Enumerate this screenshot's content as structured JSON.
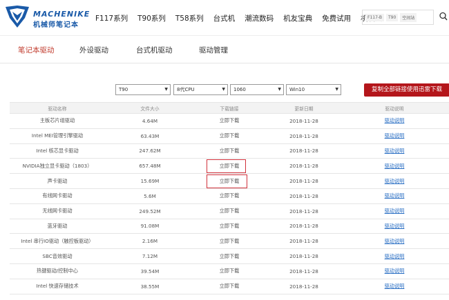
{
  "header": {
    "logo_en": "MACHENIKE",
    "logo_cn": "机械师笔记本",
    "nav": [
      "F117系列",
      "T90系列",
      "T58系列",
      "台式机",
      "潮流数码",
      "机友宝典",
      "免费试用",
      "机友会"
    ],
    "search_tags": [
      "F117-B",
      "T90",
      "空间站"
    ]
  },
  "subnav": {
    "items": [
      "笔记本驱动",
      "外设驱动",
      "台式机驱动",
      "驱动管理"
    ],
    "active": "笔记本驱动"
  },
  "filters": {
    "model": "T90",
    "cpu": "8代CPU",
    "gpu": "1060",
    "os": "Win10",
    "copy_button": "复制全部链接使用迅雷下载"
  },
  "table": {
    "headers": [
      "驱动名称",
      "文件大小",
      "下载链接",
      "更新日期",
      "驱动说明"
    ],
    "rows": [
      {
        "name": "主板芯片组驱动",
        "size": "4.64M",
        "link": "立即下载",
        "date": "2018-11-28",
        "desc": "驱动说明"
      },
      {
        "name": "Intel MEI管理引擎驱动",
        "size": "63.43M",
        "link": "立即下载",
        "date": "2018-11-28",
        "desc": "驱动说明"
      },
      {
        "name": "Intel 核芯显卡驱动",
        "size": "247.62M",
        "link": "立即下载",
        "date": "2018-11-28",
        "desc": "驱动说明"
      },
      {
        "name": "NVIDIA独立显卡驱动（1803）",
        "size": "657.48M",
        "link": "立即下载",
        "date": "2018-11-28",
        "desc": "驱动说明"
      },
      {
        "name": "声卡驱动",
        "size": "15.69M",
        "link": "立即下载",
        "date": "2018-11-28",
        "desc": "驱动说明"
      },
      {
        "name": "有线网卡驱动",
        "size": "5.6M",
        "link": "立即下载",
        "date": "2018-11-28",
        "desc": "驱动说明"
      },
      {
        "name": "无线网卡驱动",
        "size": "249.52M",
        "link": "立即下载",
        "date": "2018-11-28",
        "desc": "驱动说明"
      },
      {
        "name": "蓝牙驱动",
        "size": "91.08M",
        "link": "立即下载",
        "date": "2018-11-28",
        "desc": "驱动说明"
      },
      {
        "name": "Intel 串行IO驱动（触控板驱动）",
        "size": "2.16M",
        "link": "立即下载",
        "date": "2018-11-28",
        "desc": "驱动说明"
      },
      {
        "name": "SBC音效驱动",
        "size": "7.12M",
        "link": "立即下载",
        "date": "2018-11-28",
        "desc": "驱动说明"
      },
      {
        "name": "热键驱动/控制中心",
        "size": "39.54M",
        "link": "立即下载",
        "date": "2018-11-28",
        "desc": "驱动说明"
      },
      {
        "name": "Intel 快速存储技术",
        "size": "38.55M",
        "link": "立即下载",
        "date": "2018-11-28",
        "desc": "驱动说明"
      }
    ]
  },
  "colors": {
    "accent_red": "#b4161b",
    "brand_blue": "#1a5aa8",
    "link_blue": "#2a6fc4"
  }
}
